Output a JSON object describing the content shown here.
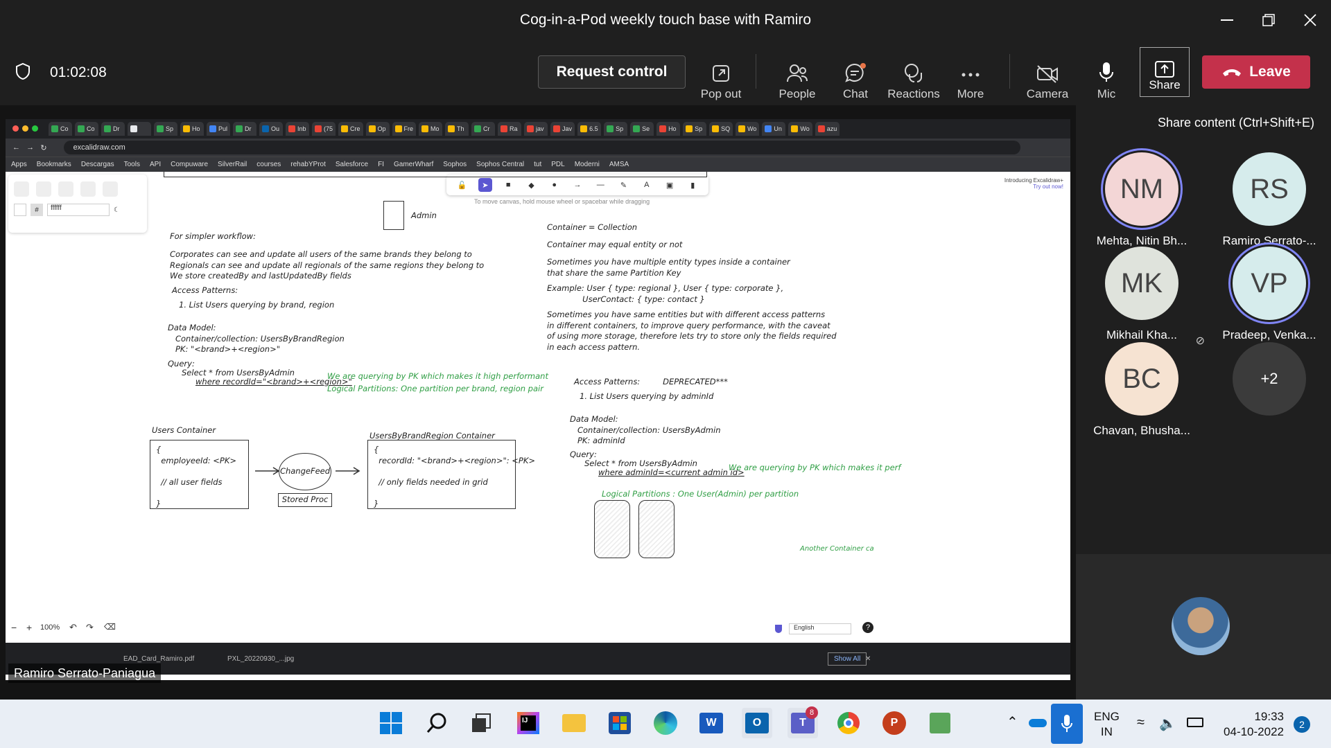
{
  "window": {
    "title": "Cog-in-a-Pod weekly touch base with Ramiro"
  },
  "toolbar": {
    "timer": "01:02:08",
    "request_control": "Request control",
    "pop_out": "Pop out",
    "people": "People",
    "chat": "Chat",
    "reactions": "Reactions",
    "more": "More",
    "camera": "Camera",
    "mic": "Mic",
    "share": "Share",
    "leave": "Leave",
    "share_tooltip": "Share content (Ctrl+Shift+E)"
  },
  "browser": {
    "url": "excalidraw.com",
    "tabs": [
      "Co",
      "Co",
      "Dr",
      "",
      "Sp",
      "Ho",
      "Pul",
      "Dr",
      "Ou",
      "Inb",
      "(75",
      "Cre",
      "Op",
      "Fre",
      "Mo",
      "Th",
      "Cr",
      "Ra",
      "jav",
      "Jav",
      "6.5",
      "Sp",
      "Se",
      "Ho",
      "Sp",
      "SQ",
      "Wo",
      "Un",
      "Wo",
      "azu"
    ],
    "bookmarks": [
      "Apps",
      "Bookmarks",
      "Descargas",
      "Tools",
      "API",
      "Compuware",
      "SilverRail",
      "courses",
      "rehabYProt",
      "Salesforce",
      "FI",
      "GamerWharf",
      "Sophos",
      "Sophos Central",
      "tut",
      "PDL",
      "Moderni",
      "AMSA"
    ]
  },
  "excalidraw": {
    "hint": "To move canvas, hold mouse wheel or spacebar while dragging",
    "color_value": "ffffff",
    "promo_title": "Introducing Excalidraw+",
    "promo_link": "Try out now!",
    "zoom": "100%",
    "language": "English",
    "admin_label": "Admin",
    "left_text": [
      "For simpler workflow:",
      "Corporates can see and update all users of the same brands they belong to\nRegionals can see and update all regionals of the same regions they belong to\nWe store createdBy and lastUpdatedBy fields",
      "Access Patterns:",
      "1. List Users querying by brand, region",
      "Data Model:\n   Container/collection: UsersByBrandRegion\n   PK: \"<brand>+<region>\"",
      "Query:",
      "Select * from UsersByAdmin",
      "where recordId=\"<brand>+<region>\""
    ],
    "left_green": [
      "We are querying by PK which makes it high performant",
      "Logical Partitions: One partition per brand, region pair"
    ],
    "right_text": [
      "Container = Collection",
      "Container may equal entity or not",
      "Sometimes you have multiple entity types inside a container\nthat share the same Partition Key",
      "Example: User { type: regional }, User { type: corporate },\n              UserContact: { type: contact }",
      "Sometimes you have same entities but with different access patterns\nin different containers, to improve query performance, with the caveat\nof using more storage, therefore lets try to store only the fields required\nin each access pattern.",
      "Access Patterns:         DEPRECATED***",
      "1. List Users querying by adminId",
      "Data Model:\n   Container/collection: UsersByAdmin\n   PK: adminId",
      "Query:",
      "Select * from UsersByAdmin",
      "where adminId=<current admin id>"
    ],
    "right_green": [
      "We are querying by PK which makes it perf",
      "Logical Partitions : One User(Admin) per partition",
      "Another Container ca"
    ],
    "diagram": {
      "users_title": "Users Container",
      "users_body": "{\n  employeeId: <PK>\n\n  // all user fields\n\n}",
      "changefeed": "ChangeFeed",
      "stored_proc": "Stored Proc",
      "ubr_title": "UsersByBrandRegion Container",
      "ubr_body": "{\n  recordId: \"<brand>+<region>\": <PK>\n\n  // only fields needed in grid\n\n}"
    }
  },
  "downloads": {
    "files": [
      "EAD_Card_Ramiro.pdf",
      "PXL_20220930_...jpg"
    ],
    "show_all": "Show All"
  },
  "presenter_name": "Ramiro Serrato-Paniagua",
  "participants": [
    {
      "initials": "NM",
      "name": "Mehta, Nitin Bh...",
      "color": "#f3d6d6"
    },
    {
      "initials": "RS",
      "name": "Ramiro Serrato-...",
      "color": "#d6ecec"
    },
    {
      "initials": "MK",
      "name": "Mikhail Kha...",
      "color": "#dfe3dc"
    },
    {
      "initials": "VP",
      "name": "Pradeep, Venka...",
      "color": "#d6ecec"
    },
    {
      "initials": "BC",
      "name": "Chavan, Bhusha...",
      "color": "#f6e3d2"
    },
    {
      "initials": "+2",
      "name": "",
      "color": "#3b3b3b"
    }
  ],
  "tray": {
    "lang1": "ENG",
    "lang2": "IN",
    "time": "19:33",
    "date": "04-10-2022",
    "notifications": "2",
    "teams_badge": "8"
  },
  "colors": {
    "leave": "#c4314b",
    "accent": "#6264a7",
    "excalidraw_accent": "#5b57d1",
    "note_green": "#2f9e44"
  }
}
